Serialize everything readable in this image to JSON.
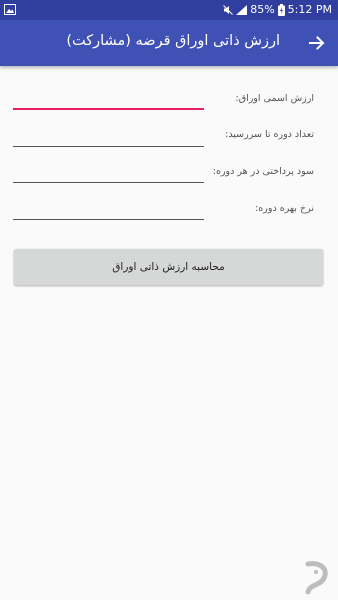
{
  "status_bar": {
    "battery": "85%",
    "time": "5:12 PM"
  },
  "app_bar": {
    "title": "ارزش ذاتی اوراق قرضه (مشارکت)",
    "back_icon": "arrow-right-icon"
  },
  "form": {
    "fields": [
      {
        "label": "ارزش اسمی اوراق:",
        "value": ""
      },
      {
        "label": "تعداد دوره تا سررسید:",
        "value": ""
      },
      {
        "label": "سود پرداختی در هر دوره:",
        "value": ""
      },
      {
        "label": "نرخ بهره دوره:",
        "value": ""
      }
    ],
    "button_label": "محاسبه ارزش ذاتی اوراق"
  },
  "colors": {
    "status_bar": "#303f9f",
    "app_bar": "#3f51b5",
    "accent": "#e91e63",
    "button": "#d6d7d7"
  }
}
